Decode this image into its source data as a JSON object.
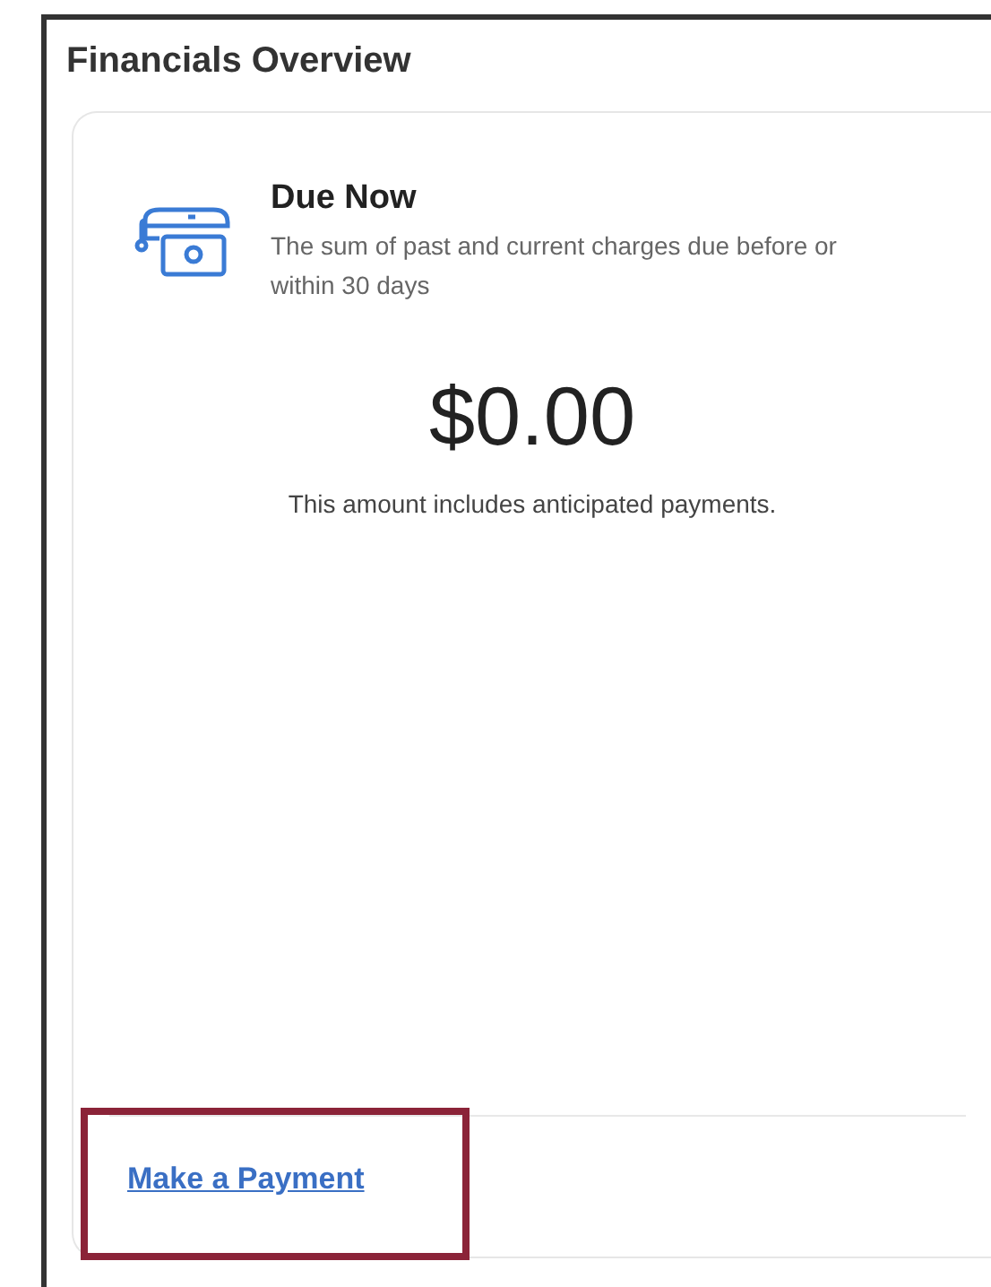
{
  "panel": {
    "title": "Financials Overview"
  },
  "card": {
    "heading": "Due Now",
    "description": "The sum of past and current charges due before or within 30 days",
    "amount": "$0.00",
    "note": "This amount includes anticipated payments."
  },
  "action": {
    "label": "Make a Payment",
    "highlighted": true
  }
}
